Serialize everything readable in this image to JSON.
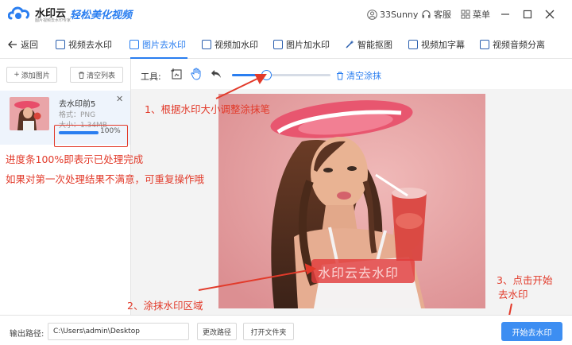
{
  "app": {
    "name": "水印云",
    "tagline": "图片视频去水印专家",
    "slogan": "轻松美化视频",
    "user": "33Sunny",
    "service": "客服",
    "menu": "菜单"
  },
  "nav": {
    "back": "返回",
    "tabs": [
      {
        "label": "视频去水印",
        "icon": "video-icon"
      },
      {
        "label": "图片去水印",
        "icon": "image-icon",
        "active": true
      },
      {
        "label": "视频加水印",
        "icon": "video-icon"
      },
      {
        "label": "图片加水印",
        "icon": "image-icon"
      },
      {
        "label": "智能抠图",
        "icon": "magic-wand-icon"
      },
      {
        "label": "视频加字幕",
        "icon": "video-icon"
      },
      {
        "label": "视频音频分离",
        "icon": "video-icon"
      }
    ]
  },
  "left_panel": {
    "add_image": "添加图片",
    "clear_list": "清空列表",
    "file": {
      "name": "去水印前5",
      "format": "格式：PNG",
      "size": "大小：1.34MB",
      "progress_percent": 100,
      "progress_label": "100%"
    }
  },
  "toolbar": {
    "label": "工具:",
    "brush_size_fraction": 0.35,
    "clear_brush": "清空涂抹"
  },
  "canvas": {
    "watermark_text": "水印云去水印"
  },
  "annotations": {
    "step1": "1、根据水印大小调整涂抹笔",
    "progress_note": "进度条100%即表示已处理完成",
    "retry_note": "如果对第一次处理结果不满意，可重复操作哦",
    "step2": "2、涂抹水印区域",
    "step3_line1": "3、点击开始",
    "step3_line2": "去水印"
  },
  "bottom": {
    "output_label": "输出路径:",
    "output_path": "C:\\Users\\admin\\Desktop",
    "change_path": "更改路径",
    "open_folder": "打开文件夹",
    "start": "开始去水印"
  },
  "colors": {
    "accent": "#2a7ef0",
    "annotation": "#e23a2a",
    "photo_background": "#e8a3a4"
  }
}
